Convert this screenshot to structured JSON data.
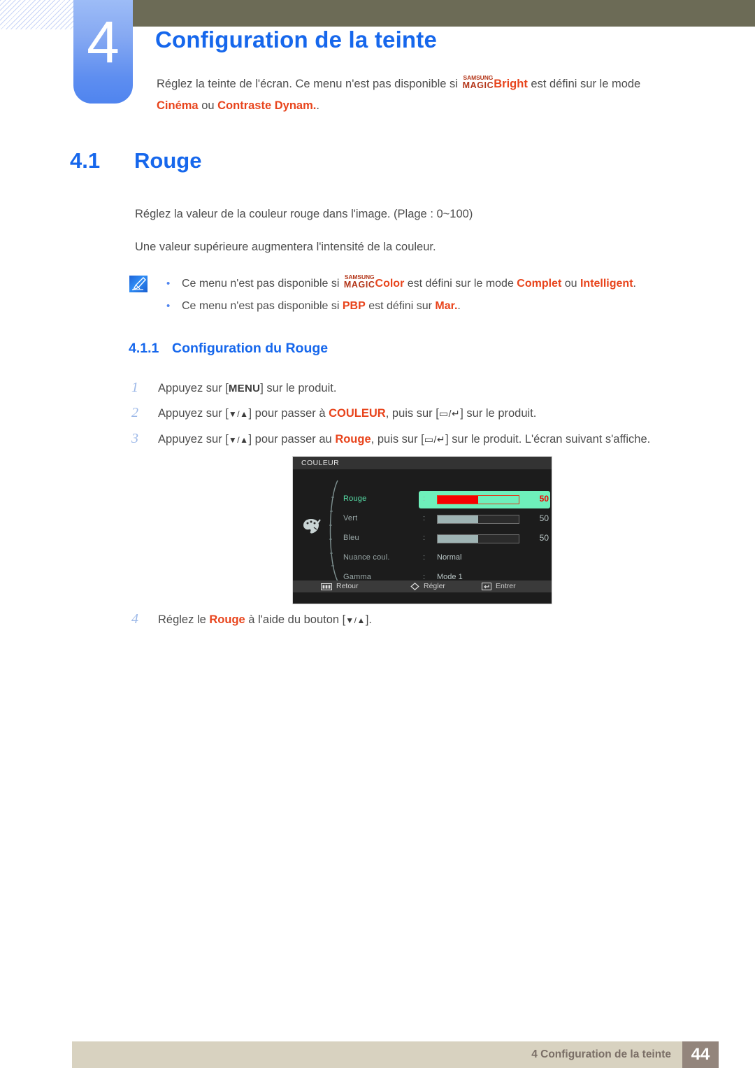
{
  "chapter": {
    "number": "4",
    "title": "Configuration de la teinte",
    "intro_before_logo": "Réglez la teinte de l'écran. Ce menu n'est pas disponible si ",
    "logo_top": "SAMSUNG",
    "logo_bottom": "MAGIC",
    "logo_suffix": "Bright",
    "intro_after_logo": " est défini sur le mode ",
    "mode_1": "Cinéma",
    "intro_join": " ou ",
    "mode_2": "Contraste Dynam.",
    "intro_end": "."
  },
  "section": {
    "number": "4.1",
    "title": "Rouge",
    "paragraph_1": "Réglez la valeur de la couleur rouge dans l'image. (Plage : 0~100)",
    "paragraph_2": "Une valeur supérieure augmentera l'intensité de la couleur."
  },
  "notes": {
    "icon": "note-pen-icon",
    "bullet_glyph": "•",
    "items": [
      {
        "prefix": "Ce menu n'est pas disponible si ",
        "logo_top": "SAMSUNG",
        "logo_bottom": "MAGIC",
        "logo_suffix": "Color",
        "middle": " est défini sur le mode ",
        "value_1": "Complet",
        "join": " ou ",
        "value_2": "Intelligent",
        "end": "."
      },
      {
        "prefix": "Ce menu n'est pas disponible si ",
        "value_1": "PBP",
        "middle": " est défini sur ",
        "value_2": "Mar.",
        "end": "."
      }
    ]
  },
  "subsection": {
    "number": "4.1.1",
    "title": "Configuration du Rouge"
  },
  "steps": [
    {
      "index": "1",
      "part_1": "Appuyez sur [",
      "key": "MENU",
      "part_2": "] sur le produit."
    },
    {
      "index": "2",
      "part_1": "Appuyez sur [",
      "key": "▼/▲",
      "part_2": "] pour passer à ",
      "highlight": "COULEUR",
      "part_3": ", puis sur [",
      "key2": "▭/↵",
      "part_4": "] sur le produit."
    },
    {
      "index": "3",
      "part_1": "Appuyez sur [",
      "key": "▼/▲",
      "part_2": "] pour passer au ",
      "highlight": "Rouge",
      "part_3": ", puis sur [",
      "key2": "▭/↵",
      "part_4": "] sur le produit. L'écran suivant s'affiche."
    },
    {
      "index": "4",
      "part_1": "Réglez le ",
      "highlight": "Rouge",
      "part_2": " à l'aide du bouton [",
      "key": "▼/▲",
      "part_3": "]."
    }
  ],
  "osd": {
    "title": "COULEUR",
    "palette_icon": "palette-icon",
    "rows": [
      {
        "label": "Rouge",
        "colon": ":",
        "kind": "slider",
        "value": "50",
        "fill_percent": 50,
        "selected": true
      },
      {
        "label": "Vert",
        "colon": ":",
        "kind": "slider",
        "value": "50",
        "fill_percent": 50,
        "selected": false
      },
      {
        "label": "Bleu",
        "colon": ":",
        "kind": "slider",
        "value": "50",
        "fill_percent": 50,
        "selected": false
      },
      {
        "label": "Nuance coul.",
        "colon": ":",
        "kind": "text",
        "value": "Normal",
        "selected": false
      },
      {
        "label": "Gamma",
        "colon": ":",
        "kind": "text",
        "value": "Mode 1",
        "selected": false
      }
    ],
    "footer": {
      "back_icon": "menu-bars-icon",
      "back_label": "Retour",
      "adjust_icon": "diamond-left-right-icon",
      "adjust_label": "Régler",
      "enter_icon": "enter-return-icon",
      "enter_label": "Entrer"
    }
  },
  "footer": {
    "text": "4 Configuration de la teinte",
    "page_number": "44"
  },
  "colors": {
    "accent_blue": "#1667ec",
    "tab_blue": "#5e8ef0",
    "highlight_red": "#e8441c",
    "olive_bar": "#6c6b56",
    "footer_bar": "#d8d2c0",
    "footer_page_box": "#93857c",
    "osd_background": "#1c1c1c",
    "osd_selection": "#6ef0bb",
    "osd_slider_red": "#f40000"
  }
}
